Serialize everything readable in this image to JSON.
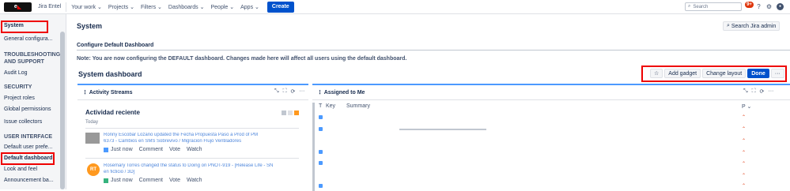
{
  "topbar": {
    "logo_text": "e",
    "app_name": "Jira Entel",
    "nav": [
      "Your work",
      "Projects",
      "Filters",
      "Dashboards",
      "People",
      "Apps"
    ],
    "create_label": "Create",
    "search_placeholder": "Search",
    "notification_count": "9+"
  },
  "sidebar": {
    "items": [
      {
        "label": "System",
        "type": "item",
        "selected": true
      },
      {
        "label": "General configura...",
        "type": "item"
      },
      {
        "label": "TROUBLESHOOTING",
        "type": "heading"
      },
      {
        "label": "AND SUPPORT",
        "type": "heading"
      },
      {
        "label": "Audit Log",
        "type": "item"
      },
      {
        "label": "SECURITY",
        "type": "heading"
      },
      {
        "label": "Project roles",
        "type": "item"
      },
      {
        "label": "Global permissions",
        "type": "item"
      },
      {
        "label": "Issue collectors",
        "type": "item"
      },
      {
        "label": "USER INTERFACE",
        "type": "heading"
      },
      {
        "label": "Default user prefe...",
        "type": "item"
      },
      {
        "label": "Default dashboard",
        "type": "item",
        "selected": true
      },
      {
        "label": "Look and feel",
        "type": "item"
      },
      {
        "label": "Announcement ba...",
        "type": "item"
      }
    ]
  },
  "main": {
    "title": "System",
    "search_admin_label": "Search Jira admin",
    "config_heading": "Configure Default Dashboard",
    "note": "Note: You are now configuring the DEFAULT dashboard. Changes made here will affect all users using the default dashboard.",
    "dashboard_title": "System dashboard",
    "toolbar": {
      "add_gadget": "Add gadget",
      "change_layout": "Change layout",
      "done": "Done",
      "more": "···"
    }
  },
  "activity_gadget": {
    "title": "Activity Streams",
    "heading": "Actividad reciente",
    "today": "Today",
    "entries": [
      {
        "text": "Ronny Escobar Lozano updated the Fecha Propuesta Paso a Prod of PM",
        "text2": "6373 - Cambios en SMS Sobrevivo / Migracion Flujo Ventiladores",
        "time": "Just now",
        "actions": [
          "Comment",
          "Vote",
          "Watch"
        ]
      },
      {
        "avatar": "RT",
        "text": "Rosemary Torres changed the status to Doing on PNOT-919 - [Release Life - SN",
        "text2": "en ficticio / 3D]",
        "time": "Just now",
        "actions": [
          "Comment",
          "Vote",
          "Watch"
        ]
      }
    ]
  },
  "assigned_gadget": {
    "title": "Assigned to Me",
    "columns": [
      "T",
      "Key",
      "Summary",
      "P"
    ]
  },
  "colors": {
    "accent": "#0052cc",
    "highlight_box": "#ee0000",
    "gadget_border": "#4c9aff",
    "avatar_rt": "#ff991f"
  }
}
